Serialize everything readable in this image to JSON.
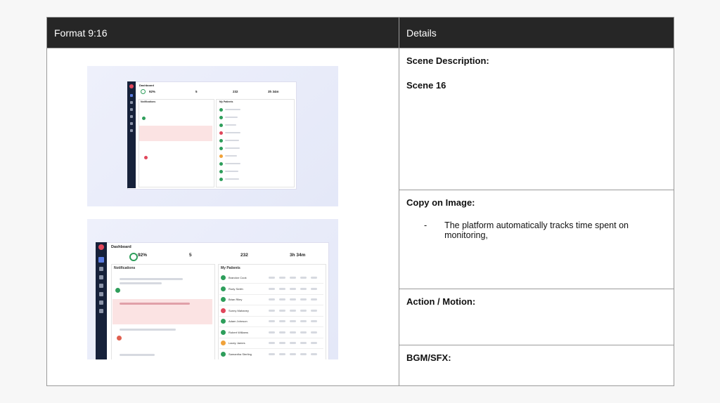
{
  "table": {
    "left_header": "Format 9:16",
    "right_header": "Details"
  },
  "details": {
    "scene_description_label": "Scene Description:",
    "scene_value": "Scene 16",
    "copy_label": "Copy on Image:",
    "copy_bullet_dash": "-",
    "copy_bullet_text": "The platform automatically tracks time spent on monitoring,",
    "action_label": "Action / Motion:",
    "bgm_label": "BGM/SFX:"
  },
  "screenshot_1": {
    "dashboard_title": "Dashboard",
    "stats": [
      "92%",
      "5",
      "232",
      "3h 34m"
    ],
    "notifications_title": "Notifications",
    "patients_title": "My Patients"
  },
  "screenshot_2": {
    "dashboard_title": "Dashboard",
    "stats": [
      "92%",
      "5",
      "232",
      "3h 34m"
    ],
    "notifications_title": "Notifications",
    "patients_title": "My Patients",
    "patients": [
      "Brandon Cook",
      "Rudy Smith",
      "Brian Riley",
      "Sunny Mahaney",
      "Adam Johnson",
      "Robert Williams",
      "Lacey James",
      "Samantha Sterling"
    ]
  },
  "colors": {
    "header_bg": "#262626",
    "sidebar": "#16213a",
    "status_green": "#2e9e5b",
    "status_red": "#e0475b",
    "status_orange": "#f0a23a",
    "alert_bg": "#fbe3e3"
  }
}
